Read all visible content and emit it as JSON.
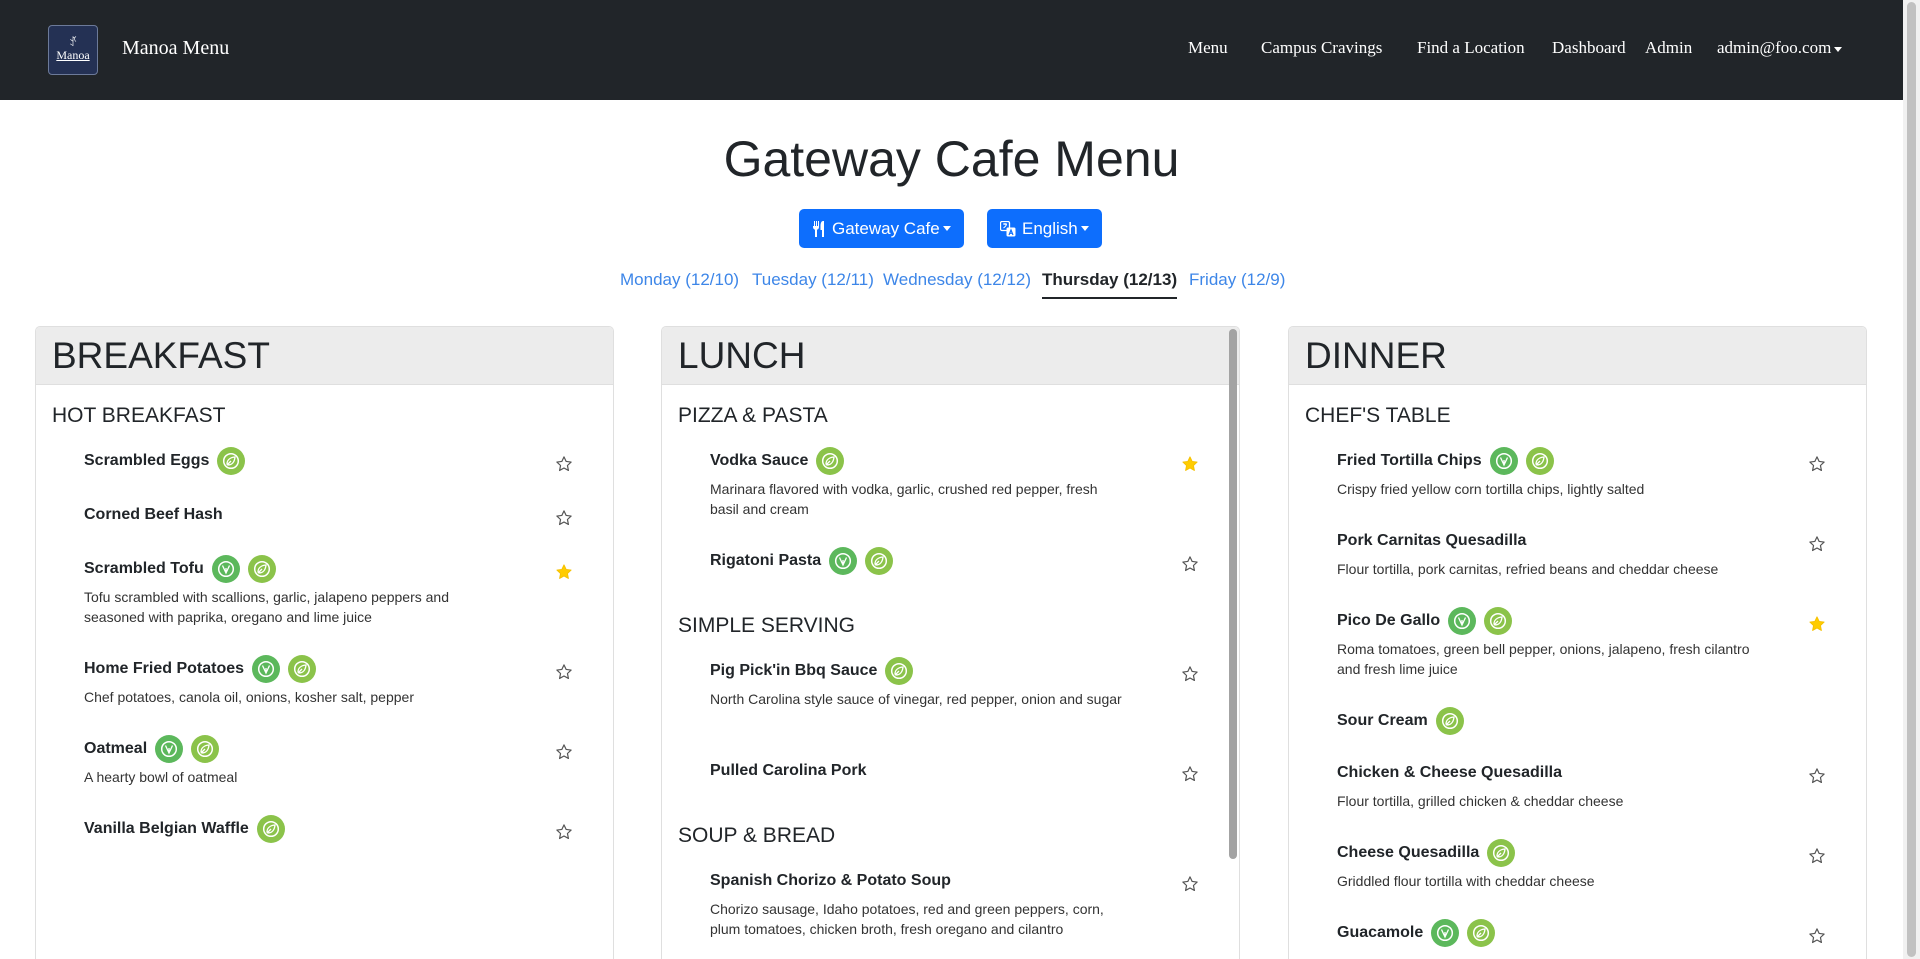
{
  "nav": {
    "logo_glyph": "ꀋ",
    "logo_word": "Manoa",
    "brand": "Manoa Menu",
    "links": [
      "Menu",
      "Campus Cravings",
      "Find a Location",
      "Dashboard",
      "Admin"
    ],
    "user": "admin@foo.com"
  },
  "page": {
    "title": "Gateway Cafe Menu",
    "location_dropdown": "Gateway Cafe",
    "language_dropdown": "English",
    "days": [
      "Monday (12/10)",
      "Tuesday (12/11)",
      "Wednesday (12/12)",
      "Thursday (12/13)",
      "Friday (12/9)"
    ],
    "active_day": "Thursday (12/13)"
  },
  "colors": {
    "primary": "#0d6efd",
    "vegan_badge": "#5cb85c",
    "vegetarian_badge": "#8bc34a",
    "favorite_star": "#ffcc00",
    "navbar": "#212529"
  },
  "meals": [
    {
      "title": "BREAKFAST",
      "stations": [
        {
          "name": "HOT BREAKFAST",
          "items": [
            {
              "name": "Scrambled Eggs",
              "badges": [
                "vegetarian"
              ],
              "desc": "",
              "favorite": false
            },
            {
              "name": "Corned Beef Hash",
              "badges": [],
              "desc": "",
              "favorite": false
            },
            {
              "name": "Scrambled Tofu",
              "badges": [
                "vegan",
                "vegetarian"
              ],
              "desc": "Tofu scrambled with scallions, garlic, jalapeno peppers and seasoned with paprika, oregano and lime juice",
              "favorite": true
            },
            {
              "name": "Home Fried Potatoes",
              "badges": [
                "vegan",
                "vegetarian"
              ],
              "desc": "Chef potatoes, canola oil, onions, kosher salt, pepper",
              "favorite": false
            },
            {
              "name": "Oatmeal",
              "badges": [
                "vegan",
                "vegetarian"
              ],
              "desc": "A hearty bowl of oatmeal",
              "favorite": false
            },
            {
              "name": "Vanilla Belgian Waffle",
              "badges": [
                "vegetarian"
              ],
              "desc": "",
              "favorite": false
            }
          ]
        }
      ]
    },
    {
      "title": "LUNCH",
      "stations": [
        {
          "name": "PIZZA & PASTA",
          "items": [
            {
              "name": "Vodka Sauce",
              "badges": [
                "vegetarian"
              ],
              "desc": "Marinara flavored with vodka, garlic, crushed red pepper, fresh basil and cream",
              "favorite": true
            },
            {
              "name": "Rigatoni Pasta",
              "badges": [
                "vegan",
                "vegetarian"
              ],
              "desc": "",
              "favorite": false
            }
          ]
        },
        {
          "name": "SIMPLE SERVING",
          "items": [
            {
              "name": "Pig Pick'in Bbq Sauce",
              "badges": [
                "vegetarian"
              ],
              "desc": "North Carolina style sauce of vinegar, red pepper, onion and sugar",
              "favorite": false
            },
            {
              "name": "Pulled Carolina Pork",
              "badges": [],
              "desc": "",
              "favorite": false
            }
          ]
        },
        {
          "name": "SOUP & BREAD",
          "items": [
            {
              "name": "Spanish Chorizo & Potato Soup",
              "badges": [],
              "desc": "Chorizo sausage, Idaho potatoes, red and green peppers, corn, plum tomatoes, chicken broth, fresh oregano and cilantro",
              "favorite": false
            }
          ]
        }
      ]
    },
    {
      "title": "DINNER",
      "stations": [
        {
          "name": "CHEF'S TABLE",
          "items": [
            {
              "name": "Fried Tortilla Chips",
              "badges": [
                "vegan",
                "vegetarian"
              ],
              "desc": "Crispy fried yellow corn tortilla chips, lightly salted",
              "favorite": false
            },
            {
              "name": "Pork Carnitas Quesadilla",
              "badges": [],
              "desc": "Flour tortilla, pork carnitas, refried beans and cheddar cheese",
              "favorite": false
            },
            {
              "name": "Pico De Gallo",
              "badges": [
                "vegan",
                "vegetarian"
              ],
              "desc": "Roma tomatoes, green bell pepper, onions, jalapeno, fresh cilantro and fresh lime juice",
              "favorite": true
            },
            {
              "name": "Sour Cream",
              "badges": [
                "vegetarian"
              ],
              "desc": "",
              "favorite": false,
              "no_star": true
            },
            {
              "name": "Chicken & Cheese Quesadilla",
              "badges": [],
              "desc": "Flour tortilla, grilled chicken & cheddar cheese",
              "favorite": false
            },
            {
              "name": "Cheese Quesadilla",
              "badges": [
                "vegetarian"
              ],
              "desc": "Griddled flour tortilla with cheddar cheese",
              "favorite": false
            },
            {
              "name": "Guacamole",
              "badges": [
                "vegan",
                "vegetarian"
              ],
              "desc": "",
              "favorite": false
            }
          ]
        }
      ]
    }
  ]
}
